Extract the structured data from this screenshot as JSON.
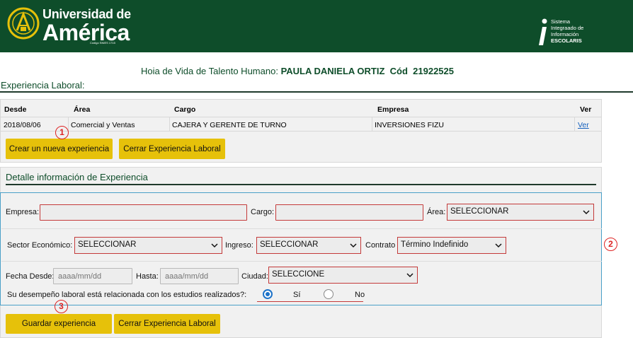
{
  "header": {
    "brand_line1": "Universidad de",
    "brand_line2": "América",
    "brand_code": "Código SNIES 1715",
    "system_lines": [
      "Sistema",
      "Integraado de",
      "Información"
    ],
    "system_name": "ESCOLARIS"
  },
  "profile": {
    "prefix": "Hoia de Vida de Talento Humano:",
    "name": "PAULA DANIELA ORTIZ",
    "code_label": "Cód",
    "code": "21922525"
  },
  "section_title": "Experiencia Laboral:",
  "grid": {
    "columns": [
      "Desde",
      "Área",
      "Cargo",
      "Empresa",
      "Ver"
    ],
    "rows": [
      {
        "desde": "2018/08/06",
        "area": "Comercial y Ventas",
        "cargo": "CAJERA Y GERENTE DE TURNO",
        "empresa": "INVERSIONES FIZU",
        "ver": "Ver"
      }
    ],
    "btn_new": "Crear un nueva experiencia",
    "btn_close": "Cerrar Experiencia Laboral"
  },
  "detail": {
    "title": "Detalle información de Experiencia",
    "labels": {
      "empresa": "Empresa:",
      "cargo": "Cargo:",
      "area": "Área:",
      "sector": "Sector Económico:",
      "ingreso": "Ingreso:",
      "contrato": "Contrato",
      "fecha_desde": "Fecha Desde:",
      "hasta": "Hasta:",
      "ciudad": "Ciudad:",
      "question": "Su desempeño laboral está relacionada con los estudios realizados?:",
      "si": "Sí",
      "no": "No"
    },
    "values": {
      "empresa": "",
      "cargo": "",
      "area": "SELECCIONAR",
      "sector": "SELECCIONAR",
      "ingreso": "SELECCIONAR",
      "contrato": "Término Indefinido",
      "ciudad": "SELECCIONE"
    },
    "placeholders": {
      "fecha_desde": "aaaa/mm/dd",
      "hasta": "aaaa/mm/dd"
    },
    "radio_selected": "si",
    "btn_save": "Guardar experiencia",
    "btn_close": "Cerrar Experiencia Laboral"
  },
  "badges": [
    "1",
    "2",
    "3"
  ],
  "colors": {
    "brand_green": "#0e4d2a",
    "accent_yellow": "#e6c10a",
    "error_red": "#c43a3a",
    "link_blue": "#1560bd",
    "radio_blue": "#1c72c8",
    "badge_red": "#dd2222"
  }
}
